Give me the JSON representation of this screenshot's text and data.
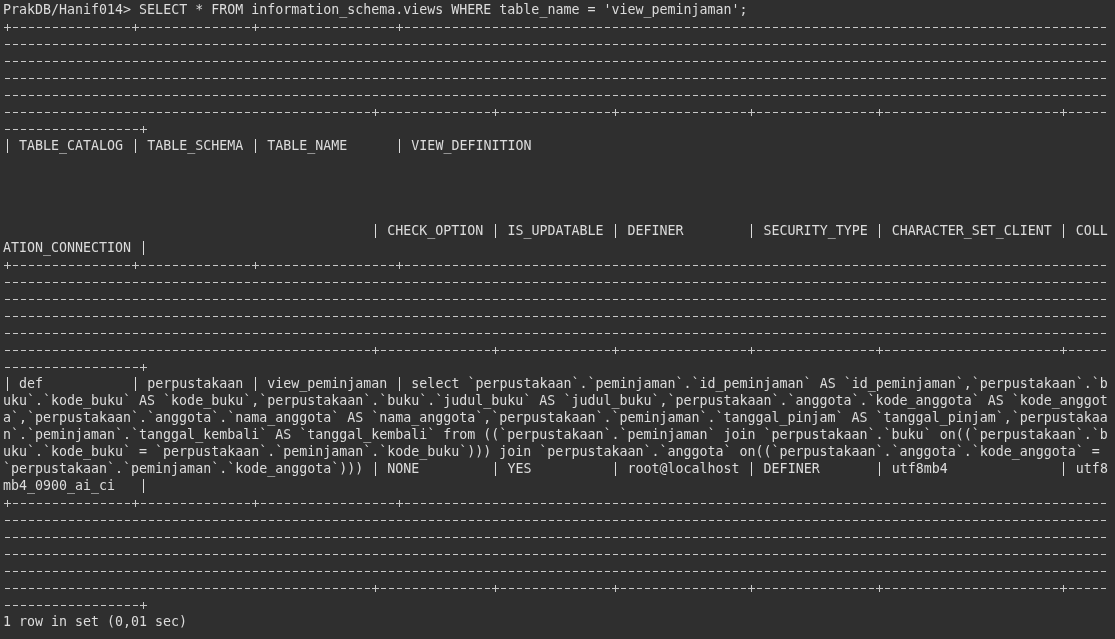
{
  "command_line": {
    "prompt": "PrakDB/Hanif014>",
    "query": "SELECT * FROM information_schema.views WHERE table_name = 'view_peminjaman';"
  },
  "result": {
    "columns": [
      "TABLE_CATALOG",
      "TABLE_SCHEMA",
      "TABLE_NAME",
      "VIEW_DEFINITION",
      "CHECK_OPTION",
      "IS_UPDATABLE",
      "DEFINER",
      "SECURITY_TYPE",
      "CHARACTER_SET_CLIENT",
      "COLLATION_CONNECTION"
    ],
    "rows": [
      [
        "def",
        "perpustakaan",
        "view_peminjaman",
        "select `perpustakaan`.`peminjaman`.`id_peminjaman` AS `id_peminjaman`,`perpustakaan`.`buku`.`kode_buku` AS `kode_buku`,`perpustakaan`.`buku`.`judul_buku` AS `judul_buku`,`perpustakaan`.`anggota`.`kode_anggota` AS `kode_anggota`,`perpustakaan`.`anggota`.`nama_anggota` AS `nama_anggota`,`perpustakaan`.`peminjaman`.`tanggal_pinjam` AS `tanggal_pinjam`,`perpustakaan`.`peminjaman`.`tanggal_kembali` AS `tanggal_kembali` from ((`perpustakaan`.`peminjaman` join `perpustakaan`.`buku` on((`perpustakaan`.`buku`.`kode_buku` = `perpustakaan`.`peminjaman`.`kode_buku`))) join `perpustakaan`.`anggota` on((`perpustakaan`.`anggota`.`kode_anggota` = `perpustakaan`.`peminjaman`.`kode_anggota`)))",
        "NONE",
        "YES",
        "root@localhost",
        "DEFINER",
        "utf8mb4",
        "utf8mb4_0900_ai_ci"
      ]
    ],
    "summary": "1 row in set (0,01 sec)"
  }
}
